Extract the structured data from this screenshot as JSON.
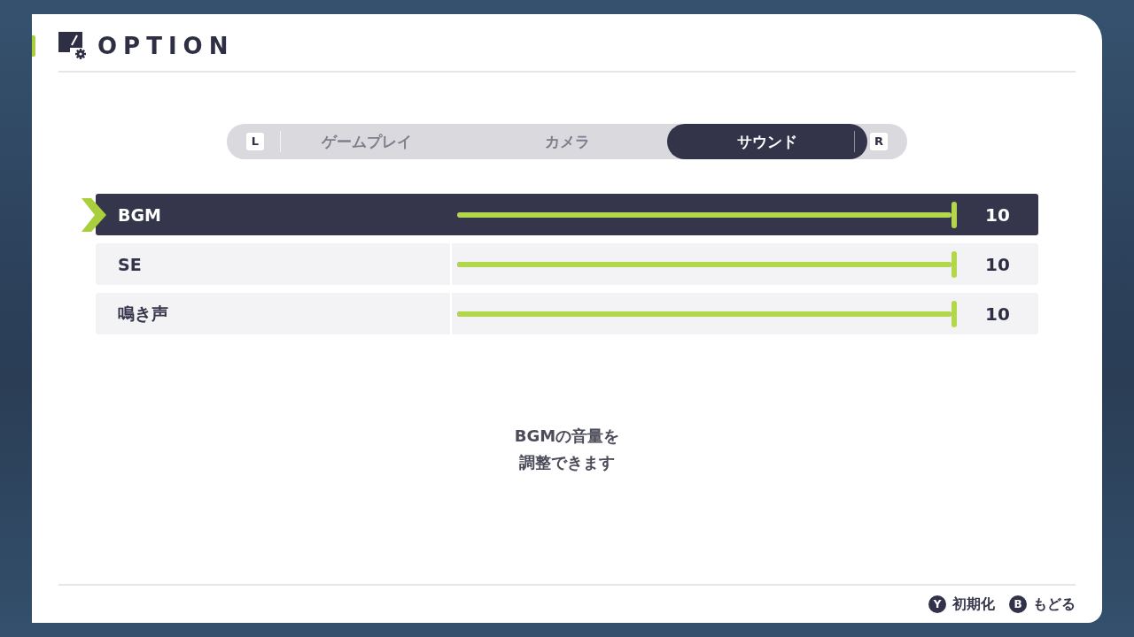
{
  "header": {
    "title": "OPTION"
  },
  "tabs": {
    "prev_key": "L",
    "next_key": "R",
    "items": [
      {
        "label": "ゲームプレイ",
        "selected": false
      },
      {
        "label": "カメラ",
        "selected": false
      },
      {
        "label": "サウンド",
        "selected": true
      }
    ]
  },
  "settings": [
    {
      "name": "BGM",
      "selected": true,
      "level": 1,
      "value": "10"
    },
    {
      "name": "SE",
      "selected": false,
      "level": 1,
      "value": "10"
    },
    {
      "name": "鳴き声",
      "selected": false,
      "level": 1,
      "value": "10"
    }
  ],
  "description_lines": [
    "BGMの音量を",
    "調整できます"
  ],
  "footer": [
    {
      "key": "Y",
      "label": "初期化"
    },
    {
      "key": "B",
      "label": "もどる"
    }
  ]
}
